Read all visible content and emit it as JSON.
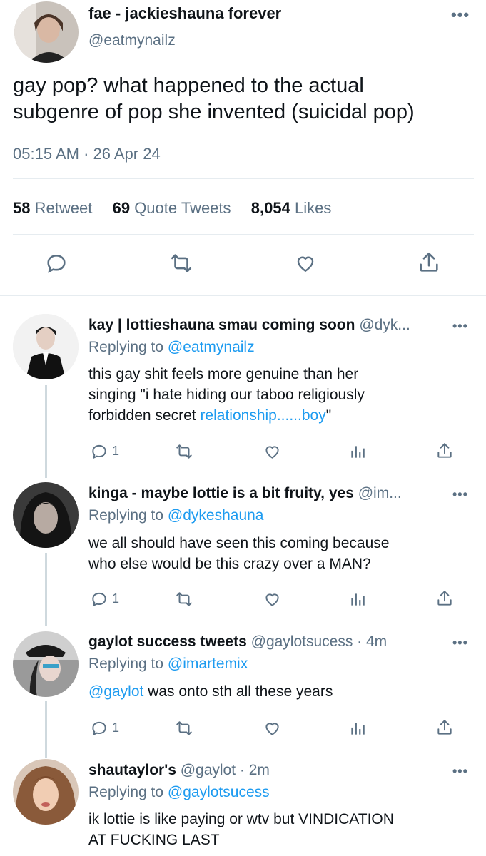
{
  "main_tweet": {
    "display_name": "fae - jackieshauna forever",
    "handle": "@eatmynailz",
    "text_line1": "gay pop? what happened to the actual",
    "text_line2": "subgenre of pop she invented (suicidal pop)",
    "timestamp": "05:15 AM · 26 Apr 24",
    "retweets_count": "58",
    "retweets_label": "Retweet",
    "quotes_count": "69",
    "quotes_label": "Quote Tweets",
    "likes_count": "8,054",
    "likes_label": "Likes"
  },
  "replies": [
    {
      "display_name": "kay | lottieshauna smau coming soon",
      "handle": "@dyk...",
      "replying_prefix": "Replying to ",
      "replying_to": "@eatmynailz",
      "text_line1": "this gay shit feels more genuine than her",
      "text_line2": "singing \"i hate hiding our taboo religiously",
      "text_line3_a": "forbidden secret ",
      "text_line3_link": "relationship......boy",
      "text_line3_b": "\"",
      "reply_count": "1"
    },
    {
      "display_name": "kinga - maybe lottie is a bit fruity, yes",
      "handle": "@im...",
      "replying_prefix": "Replying to ",
      "replying_to": "@dykeshauna",
      "text_line1": "we all should have seen this coming because",
      "text_line2": "who else would be this crazy over a MAN?",
      "reply_count": "1"
    },
    {
      "display_name": "gaylot success tweets",
      "handle": "@gaylotsucess",
      "time": " · 4m",
      "replying_prefix": "Replying to ",
      "replying_to": "@imartemix",
      "text_link": "@gaylot",
      "text_rest": " was onto sth all these years",
      "reply_count": "1"
    },
    {
      "display_name": "shautaylor's",
      "handle": "@gaylot",
      "time": " · 2m",
      "replying_prefix": "Replying to ",
      "replying_to": "@gaylotsucess",
      "text_line1": "ik lottie is like paying or wtv but VINDICATION",
      "text_line2": "AT FUCKING LAST"
    }
  ],
  "colors": {
    "link": "#1d9bf0",
    "muted": "#5b7083",
    "divider": "#e6ecf0"
  },
  "icons": [
    "reply-icon",
    "retweet-icon",
    "like-icon",
    "share-icon",
    "analytics-icon",
    "more-icon"
  ]
}
